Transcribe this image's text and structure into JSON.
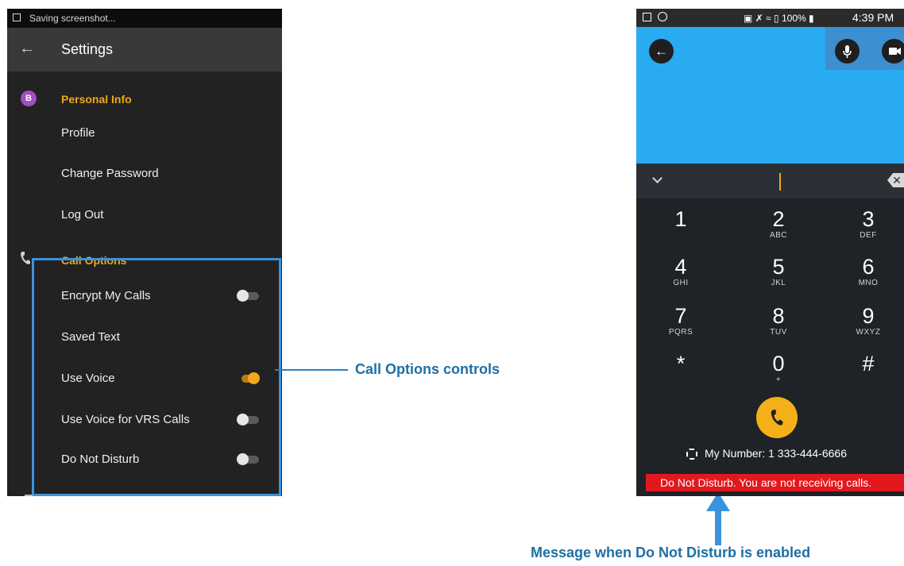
{
  "settings": {
    "status_text": "Saving screenshot...",
    "title": "Settings",
    "avatar_letter": "B",
    "personal_info": {
      "header": "Personal Info",
      "items": [
        "Profile",
        "Change Password",
        "Log Out"
      ]
    },
    "call_options": {
      "header": "Call Options",
      "items": [
        {
          "label": "Encrypt My Calls",
          "toggle": "off"
        },
        {
          "label": "Saved Text",
          "toggle": null
        },
        {
          "label": "Use Voice",
          "toggle": "on"
        },
        {
          "label": "Use Voice for VRS Calls",
          "toggle": "off"
        },
        {
          "label": "Do Not Disturb",
          "toggle": "off"
        }
      ]
    }
  },
  "callouts": {
    "call_options": "Call Options controls",
    "dnd": "Message when Do Not Disturb is enabled"
  },
  "dialer": {
    "status_right": "100%",
    "time": "4:39 PM",
    "delete_glyph": "✕",
    "keys": [
      {
        "digit": "1",
        "letters": ""
      },
      {
        "digit": "2",
        "letters": "ABC"
      },
      {
        "digit": "3",
        "letters": "DEF"
      },
      {
        "digit": "4",
        "letters": "GHI"
      },
      {
        "digit": "5",
        "letters": "JKL"
      },
      {
        "digit": "6",
        "letters": "MNO"
      },
      {
        "digit": "7",
        "letters": "PQRS"
      },
      {
        "digit": "8",
        "letters": "TUV"
      },
      {
        "digit": "9",
        "letters": "WXYZ"
      },
      {
        "digit": "*",
        "letters": ""
      },
      {
        "digit": "0",
        "letters": "+"
      },
      {
        "digit": "#",
        "letters": ""
      }
    ],
    "my_number": "My Number: 1 333-444-6666",
    "dnd_message": "Do Not Disturb. You are not receiving calls.",
    "colors": {
      "accent": "#f4b018",
      "video": "#29abf1",
      "dnd_bar": "#e1191f",
      "callout": "#1d6fa5"
    }
  }
}
